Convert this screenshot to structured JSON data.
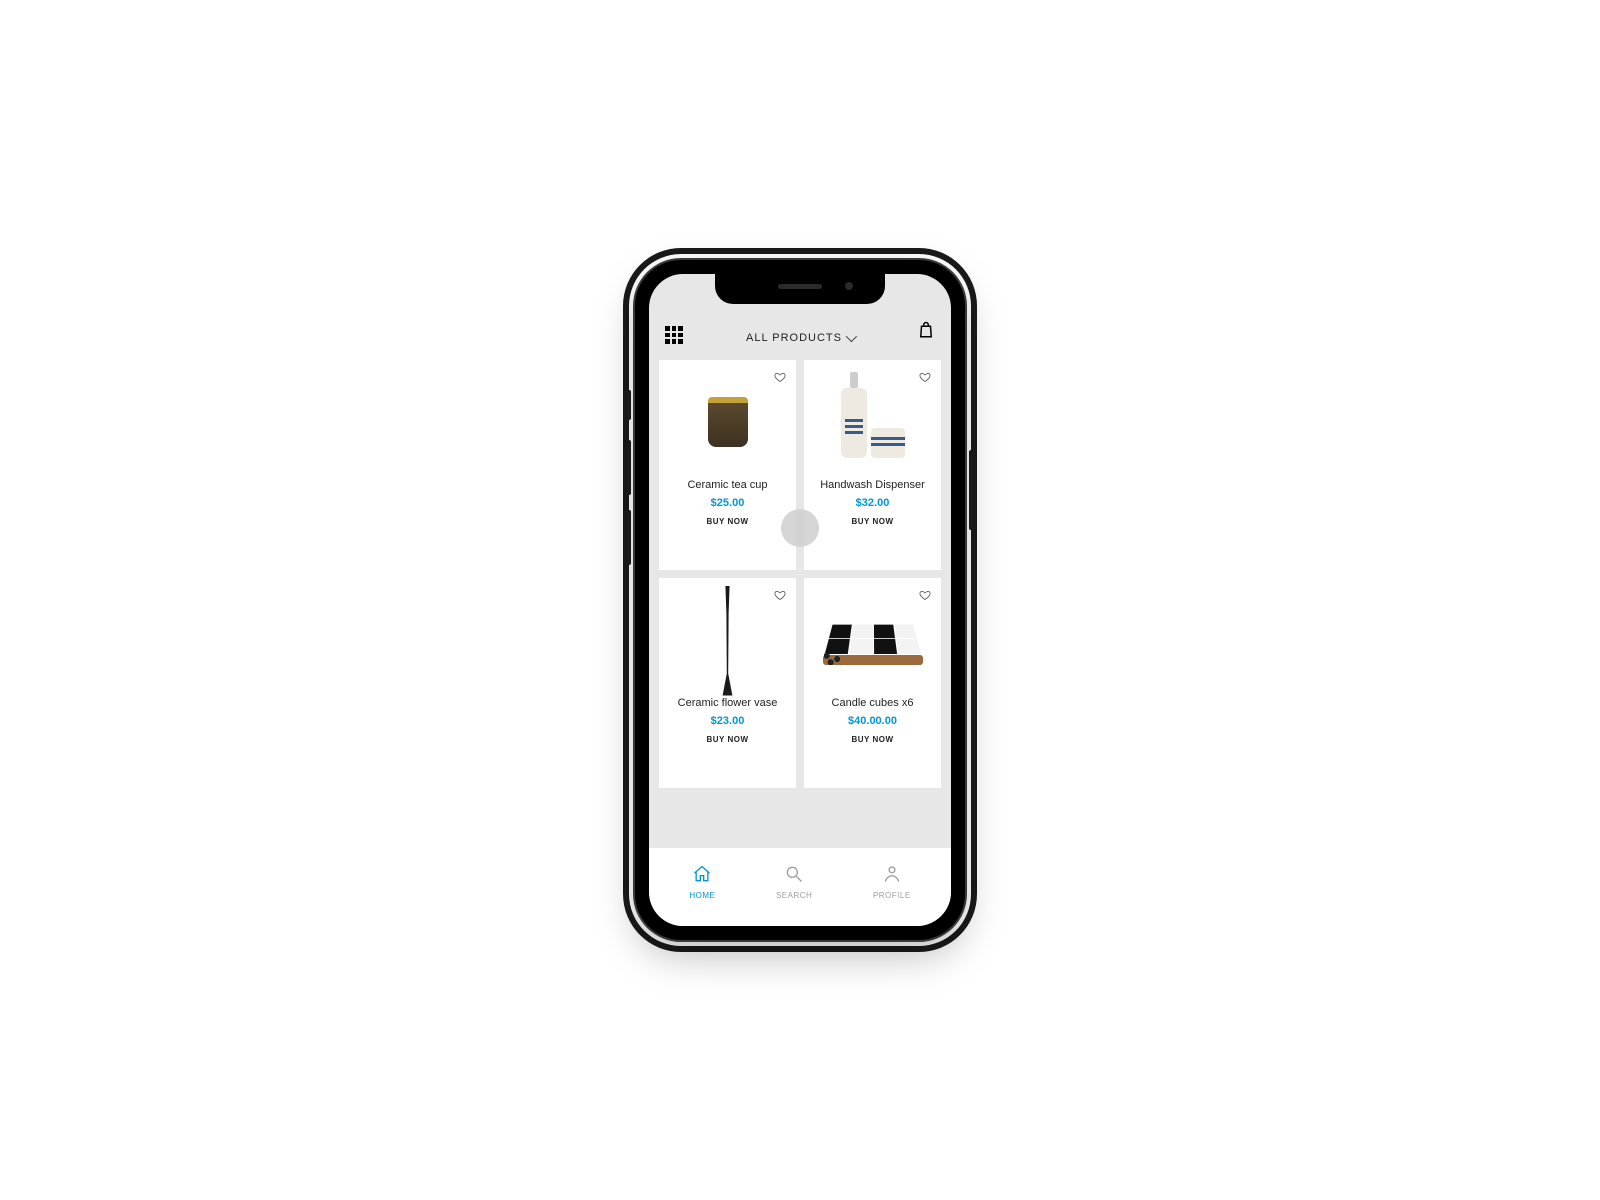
{
  "header": {
    "title": "ALL PRODUCTS"
  },
  "products": [
    {
      "name": "Ceramic tea cup",
      "price": "$25.00",
      "buy": "BUY NOW"
    },
    {
      "name": "Handwash Dispenser",
      "price": "$32.00",
      "buy": "BUY NOW"
    },
    {
      "name": "Ceramic flower vase",
      "price": "$23.00",
      "buy": "BUY NOW"
    },
    {
      "name": "Candle cubes x6",
      "price": "$40.00.00",
      "buy": "BUY NOW"
    }
  ],
  "nav": {
    "home": "HOME",
    "search": "SEARCH",
    "profile": "PROFILE"
  }
}
